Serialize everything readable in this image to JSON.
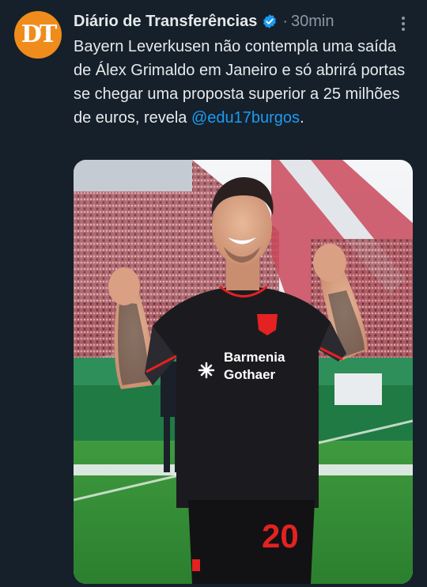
{
  "account": {
    "avatar_initials": "DT",
    "name": "Diário de Transferências",
    "separator": "·",
    "time": "30min"
  },
  "tweet": {
    "text": "Bayern Leverkusen não contempla uma saída de Álex Grimaldo em Janeiro e só abrirá portas se chegar uma proposta superior a 25 milhões de euros, revela ",
    "mention": "@edu17burgos",
    "tail": "."
  },
  "media": {
    "kit_sponsor_line1": "Barmenia",
    "kit_sponsor_line2": "Gothaer",
    "shirt_number": "20"
  },
  "colors": {
    "background": "#15202b",
    "accent": "#1d9bf0",
    "avatar": "#f08c1c",
    "kit_red": "#e32221"
  },
  "icons": [
    "verified-badge-icon",
    "more-options-icon"
  ]
}
